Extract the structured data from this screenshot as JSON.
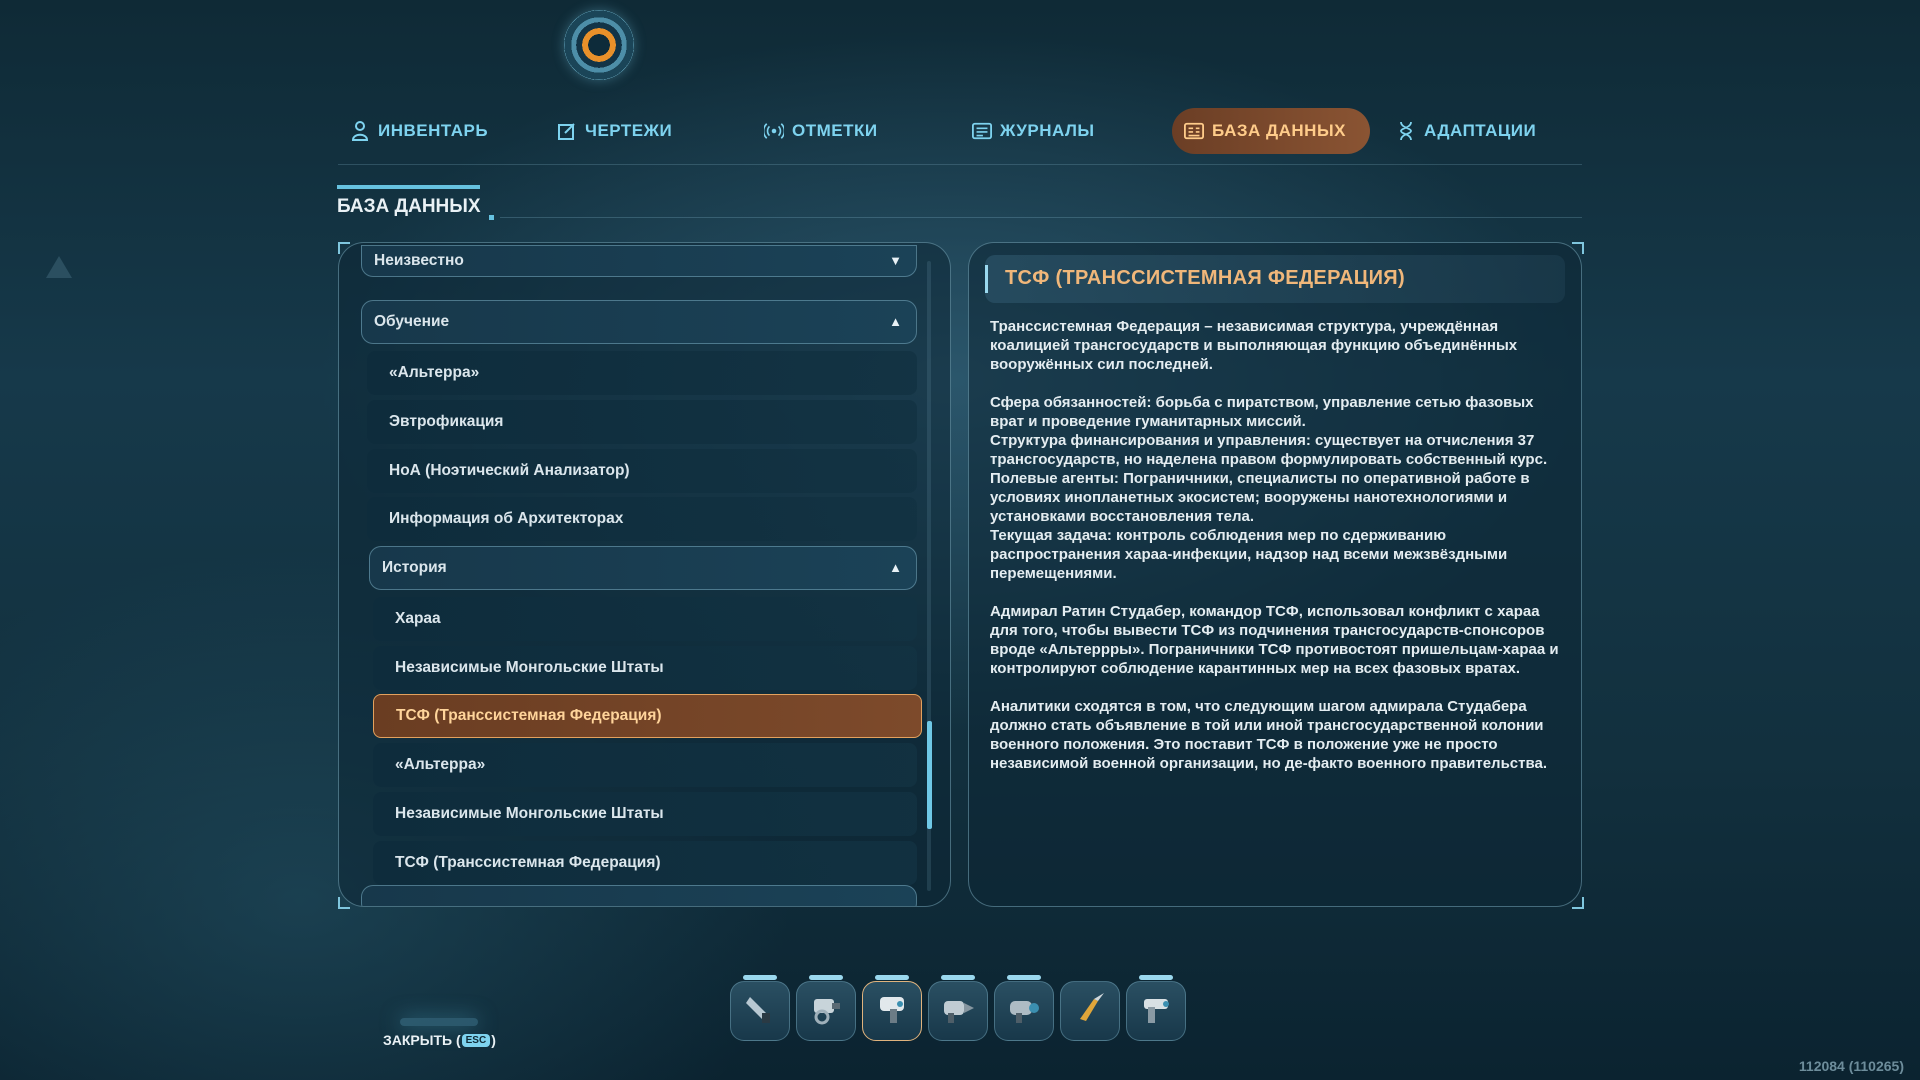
{
  "nav": {
    "tabs": [
      {
        "label": "ИНВЕНТАРЬ",
        "icon": "person-icon",
        "active": false
      },
      {
        "label": "ЧЕРТЕЖИ",
        "icon": "blueprint-icon",
        "active": false
      },
      {
        "label": "ОТМЕТКИ",
        "icon": "signal-icon",
        "active": false
      },
      {
        "label": "ЖУРНАЛЫ",
        "icon": "journal-icon",
        "active": false
      },
      {
        "label": "БАЗА ДАННЫХ",
        "icon": "database-icon",
        "active": true
      },
      {
        "label": "АДАПТАЦИИ",
        "icon": "dna-icon",
        "active": false
      }
    ]
  },
  "section": {
    "title": "БАЗА ДАННЫХ"
  },
  "list": {
    "items": [
      {
        "label": "Неизвестно",
        "kind": "header",
        "state": "collapsed"
      },
      {
        "label": "Обучение",
        "kind": "header",
        "state": "expanded"
      },
      {
        "label": "«Альтерра»",
        "kind": "entry"
      },
      {
        "label": "Эвтрофикация",
        "kind": "entry"
      },
      {
        "label": "НоА (Ноэтический Анализатор)",
        "kind": "entry"
      },
      {
        "label": "Информация об Архитекторах",
        "kind": "entry"
      },
      {
        "label": "История",
        "kind": "subheader",
        "state": "expanded"
      },
      {
        "label": "Хараа",
        "kind": "subentry"
      },
      {
        "label": "Независимые Монгольские Штаты",
        "kind": "subentry"
      },
      {
        "label": "ТСФ (Транссистемная Федерация)",
        "kind": "subentry",
        "selected": true
      },
      {
        "label": "«Альтерра»",
        "kind": "subentry"
      },
      {
        "label": "Независимые Монгольские Штаты",
        "kind": "subentry"
      },
      {
        "label": "ТСФ (Транссистемная Федерация)",
        "kind": "subentry"
      }
    ]
  },
  "detail": {
    "title": "ТСФ (ТРАНССИСТЕМНАЯ ФЕДЕРАЦИЯ)",
    "paragraphs": [
      "Транссистемная Федерация – независимая структура, учреждённая коалицией трансгосударств и выполняющая функцию объединённых вооружённых сил последней.",
      "Сфера обязанностей: борьба с пиратством, управление сетью фазовых врат и проведение гуманитарных миссий.\nСтруктура финансирования и управления: существует на отчисления 37 трансгосударств, но наделена правом формулировать собственный курс.\nПолевые агенты: Пограничники, специалисты по оперативной работе в условиях инопланетных экосистем; вооружены нанотехнологиями и установками восстановления тела.\nТекущая задача: контроль соблюдения мер по сдерживанию распространения хараа-инфекции, надзор над всеми межзвёздными перемещениями.",
      "Адмирал Ратин Студабер, командор ТСФ, использовал конфликт с хараа для того, чтобы вывести ТСФ из подчинения трансгосударств-спонсоров вроде «Альтеррры». Пограничники ТСФ противостоят пришельцам-хараа и контролируют соблюдение карантинных мер на всех фазовых вратах.",
      "Аналитики сходятся в том, что следующим шагом адмирала Студабера должно стать объявление в той или иной трансгосударственной колонии военного положения. Это поставит ТСФ в положение уже не просто независимой военной организации, но де-факто военного правительства."
    ]
  },
  "hotbar": {
    "slots": [
      {
        "icon": "scanner-tool-icon",
        "active": false
      },
      {
        "icon": "repair-tool-icon",
        "active": false
      },
      {
        "icon": "builder-tool-icon",
        "active": true
      },
      {
        "icon": "drill-tool-icon",
        "active": false
      },
      {
        "icon": "propulsion-tool-icon",
        "active": false
      },
      {
        "icon": "knife-tool-icon",
        "active": false
      },
      {
        "icon": "pistol-tool-icon",
        "active": false
      }
    ]
  },
  "footer": {
    "close_label": "ЗАКРЫТЬ (",
    "close_key": "ESC",
    "close_suffix": ")",
    "build_id": "112084 (110265)"
  },
  "colors": {
    "accent": "#7ed3ef",
    "active_tab": "#8a5433",
    "active_text": "#ffcc8a",
    "title_orange": "#f0b77a"
  }
}
